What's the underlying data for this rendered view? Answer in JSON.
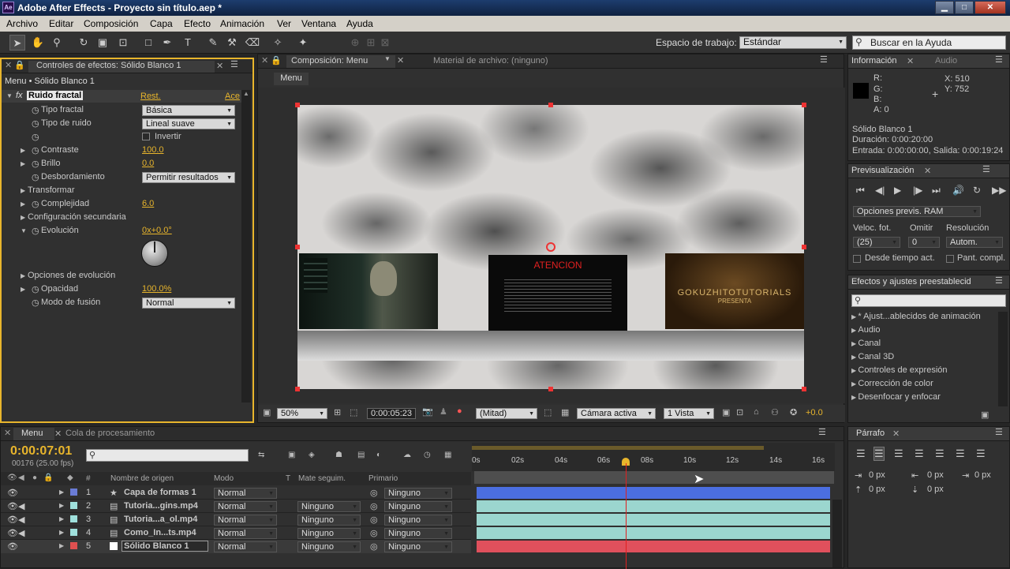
{
  "app": {
    "title": "Adobe After Effects - Proyecto sin título.aep *",
    "logo": "Ae",
    "min": "▁",
    "max": "□",
    "close": "✕"
  },
  "menu": [
    "Archivo",
    "Editar",
    "Composición",
    "Capa",
    "Efecto",
    "Animación",
    "Ver",
    "Ventana",
    "Ayuda"
  ],
  "toolbar": {
    "workspace_label": "Espacio de trabajo:",
    "workspace_value": "Estándar",
    "help_placeholder": "Buscar en la Ayuda"
  },
  "effects_panel": {
    "tab": "Controles de efectos: Sólido Blanco 1",
    "breadcrumb": "Menu • Sólido Blanco 1",
    "effect_name": "Ruido fractal",
    "reset": "Rest.",
    "about": "Ace",
    "props": [
      {
        "label": "Tipo fractal",
        "value": "Básica",
        "type": "dd"
      },
      {
        "label": "Tipo de ruido",
        "value": "Lineal suave",
        "type": "dd"
      },
      {
        "label": "",
        "value": "Invertir",
        "type": "check"
      },
      {
        "label": "Contraste",
        "value": "100.0",
        "type": "num"
      },
      {
        "label": "Brillo",
        "value": "0.0",
        "type": "num"
      },
      {
        "label": "Desbordamiento",
        "value": "Permitir resultados",
        "type": "dd"
      },
      {
        "label": "Transformar",
        "value": "",
        "type": "group"
      },
      {
        "label": "Complejidad",
        "value": "6.0",
        "type": "num"
      },
      {
        "label": "Configuración secundaria",
        "value": "",
        "type": "group"
      },
      {
        "label": "Evolución",
        "value": "0x+0.0°",
        "type": "num"
      },
      {
        "label": "Opciones de evolución",
        "value": "",
        "type": "group"
      },
      {
        "label": "Opacidad",
        "value": "100.0%",
        "type": "num"
      },
      {
        "label": "Modo de fusión",
        "value": "Normal",
        "type": "dd"
      }
    ]
  },
  "comp_panel": {
    "tab": "Composición: Menu",
    "footage_tab": "Material de archivo: (ninguno)",
    "comp_button": "Menu",
    "attention_title": "ATENCION",
    "credit_text": "GOKUZHITOTUTORIALS",
    "credit_sub": "PRESENTA",
    "zoom": "50%",
    "timecode": "0:00:05:23",
    "resolution": "(Mitad)",
    "camera": "Cámara activa",
    "views": "1 Vista",
    "exposure": "+0.0"
  },
  "info_panel": {
    "tab": "Información",
    "tab2": "Audio",
    "r": "R:",
    "g": "G:",
    "b": "B:",
    "a": "A:  0",
    "x": "X:  510",
    "y": "Y:  752",
    "name": "Sólido Blanco 1",
    "duration": "Duración: 0:00:20:00",
    "inout": "Entrada: 0:00:00:00, Salida: 0:00:19:24"
  },
  "preview_panel": {
    "tab": "Previsualización",
    "options": "Opciones previs. RAM",
    "fps_label": "Veloc. fot.",
    "skip_label": "Omitir",
    "res_label": "Resolución",
    "fps": "(25)",
    "skip": "0",
    "res": "Autom.",
    "from_current": "Desde tiempo act.",
    "fullscreen": "Pant. compl."
  },
  "effects_presets": {
    "tab": "Efectos y ajustes preestablecid",
    "items": [
      "* Ajust...ablecidos de animación",
      "Audio",
      "Canal",
      "Canal 3D",
      "Controles de expresión",
      "Corrección de color",
      "Desenfocar y enfocar"
    ]
  },
  "timeline": {
    "tab": "Menu",
    "render_tab": "Cola de procesamiento",
    "timecode": "0:00:07:01",
    "frames": "00176 (25.00 fps)",
    "columns": {
      "num": "#",
      "source": "Nombre de origen",
      "mode": "Modo",
      "t": "T",
      "matte": "Mate seguim.",
      "parent": "Primario"
    },
    "ruler": [
      "0s",
      "02s",
      "04s",
      "06s",
      "08s",
      "10s",
      "12s",
      "14s",
      "16s"
    ],
    "layers": [
      {
        "num": "1",
        "name": "Capa de formas 1",
        "mode": "Normal",
        "matte": "",
        "parent": "Ninguno",
        "color": "#6a7cd6",
        "bar": "#4b6ee0"
      },
      {
        "num": "2",
        "name": "Tutoria...gins.mp4",
        "mode": "Normal",
        "matte": "Ninguno",
        "parent": "Ninguno",
        "color": "#9fe0dc",
        "bar": "#9bd6cf"
      },
      {
        "num": "3",
        "name": "Tutoria...a_ol.mp4",
        "mode": "Normal",
        "matte": "Ninguno",
        "parent": "Ninguno",
        "color": "#9fe0dc",
        "bar": "#9bd6cf"
      },
      {
        "num": "4",
        "name": "Como_In...ts.mp4",
        "mode": "Normal",
        "matte": "Ninguno",
        "parent": "Ninguno",
        "color": "#9fe0dc",
        "bar": "#9bd6cf"
      },
      {
        "num": "5",
        "name": "Sólido Blanco 1",
        "mode": "Normal",
        "matte": "Ninguno",
        "parent": "Ninguno",
        "color": "#e05050",
        "bar": "#e0505c"
      }
    ]
  },
  "paragraph": {
    "tab": "Párrafo",
    "v1": "0 px",
    "v2": "0 px",
    "v3": "0 px",
    "v4": "0 px",
    "v5": "0 px"
  }
}
